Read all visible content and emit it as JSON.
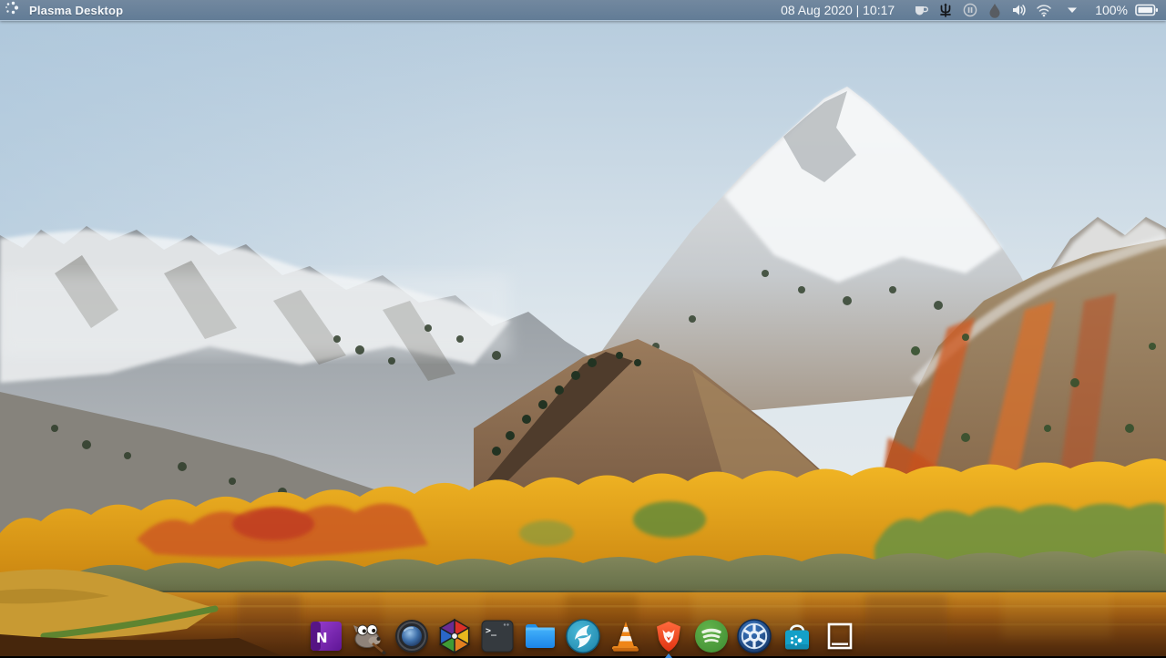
{
  "panel": {
    "title": "Plasma Desktop",
    "clock": "08 Aug 2020 | 10:17",
    "launcher_icon": "plasma-dots-logo",
    "tray": {
      "icons": [
        "coffee-cup-icon",
        "trident-icon",
        "pause-circle-icon",
        "water-drop-icon",
        "volume-icon",
        "wifi-icon",
        "chevron-down-icon"
      ],
      "battery_percent": "100%",
      "battery_icon": "battery-full-icon"
    },
    "colors": {
      "panel_bg": "#66809b",
      "panel_text": "#f4f7fa"
    }
  },
  "dock": {
    "items": [
      {
        "name": "onenote",
        "icon": "onenote-n-icon",
        "letter": "N"
      },
      {
        "name": "gimp",
        "icon": "gimp-wilber-icon"
      },
      {
        "name": "camera-lens-app",
        "icon": "camera-lens-icon"
      },
      {
        "name": "color-shutter-app",
        "icon": "color-shutter-icon"
      },
      {
        "name": "terminal",
        "icon": "terminal-icon",
        "prompt": ">_"
      },
      {
        "name": "file-manager",
        "icon": "blue-folder-icon"
      },
      {
        "name": "falkon-browser",
        "icon": "falkon-bird-icon"
      },
      {
        "name": "vlc",
        "icon": "vlc-cone-icon"
      },
      {
        "name": "brave-browser",
        "icon": "brave-lion-icon",
        "active": true
      },
      {
        "name": "spotify",
        "icon": "spotify-waves-icon"
      },
      {
        "name": "system-settings",
        "icon": "gear-wheel-icon"
      },
      {
        "name": "discover-store",
        "icon": "shopping-bag-icon"
      },
      {
        "name": "window-outline",
        "icon": "white-square-icon"
      }
    ],
    "active_indicator_color": "#3b8de0"
  },
  "wallpaper": {
    "name": "autumn-mountain-lake",
    "palette": {
      "sky_top": "#b5cbdd",
      "sky_low": "#e6ebee",
      "snow": "#f4f6f7",
      "rock_gray": "#9aa0a6",
      "slope_brown": "#8f6f52",
      "foliage_orange": "#cd5a20",
      "foliage_yellow": "#f0ad1f",
      "foliage_green": "#6f9340",
      "water_gold": "#c47417",
      "water_dark": "#5e3410"
    }
  }
}
